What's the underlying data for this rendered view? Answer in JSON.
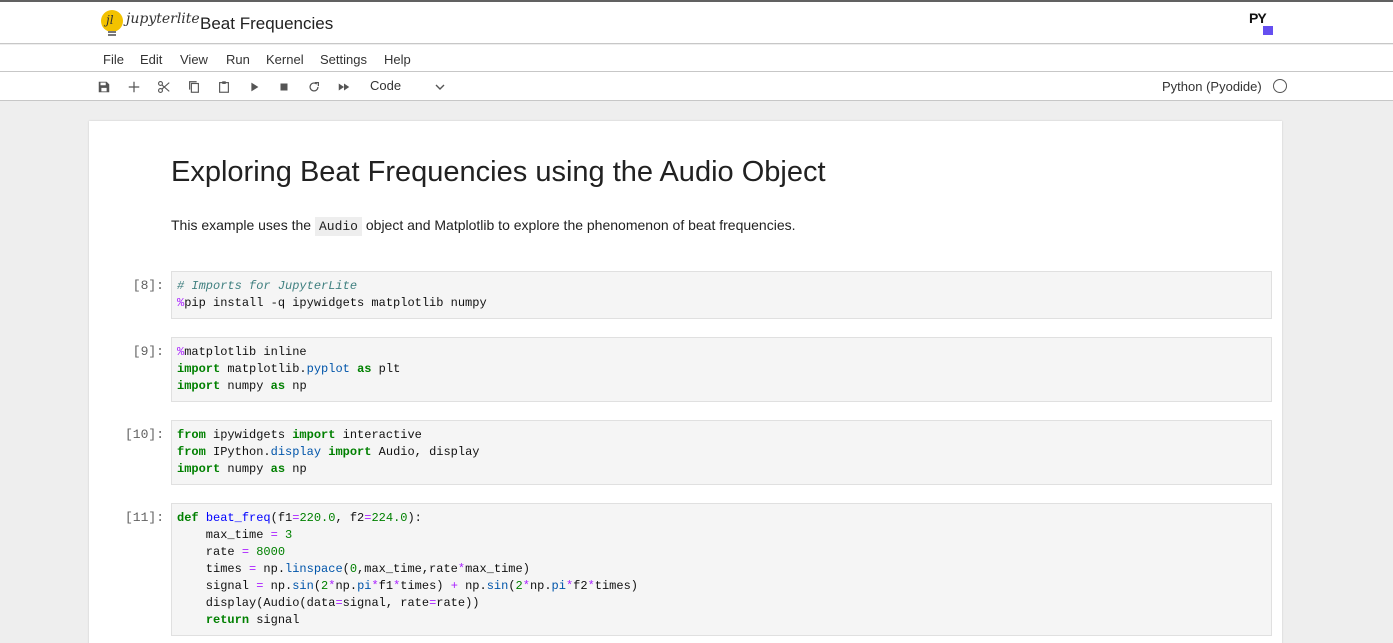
{
  "app": {
    "name": "jupyterlite",
    "document_title": "Beat Frequencies",
    "badge_text": "PY"
  },
  "menu": [
    "File",
    "Edit",
    "View",
    "Run",
    "Kernel",
    "Settings",
    "Help"
  ],
  "toolbar": {
    "buttons": [
      "save-icon",
      "add-icon",
      "cut-icon",
      "copy-icon",
      "paste-icon",
      "run-icon",
      "stop-icon",
      "restart-icon",
      "fast-forward-icon"
    ],
    "cell_type": "Code",
    "kernel_name": "Python (Pyodide)"
  },
  "notebook": {
    "title": "Exploring Beat Frequencies using the Audio Object",
    "intro_before": "This example uses the ",
    "intro_code": "Audio",
    "intro_after": " object and Matplotlib to explore the phenomenon of beat frequencies.",
    "cells": [
      {
        "prompt": "[8]:",
        "lines": [
          [
            {
              "t": "# Imports for JupyterLite",
              "c": "c-com"
            }
          ],
          [
            {
              "t": "%",
              "c": "c-mag"
            },
            {
              "t": "pip install -q ipywidgets matplotlib numpy",
              "c": ""
            }
          ]
        ]
      },
      {
        "prompt": "[9]:",
        "lines": [
          [
            {
              "t": "%",
              "c": "c-mag"
            },
            {
              "t": "matplotlib inline",
              "c": ""
            }
          ],
          [
            {
              "t": "import",
              "c": "c-kw"
            },
            {
              "t": " matplotlib.",
              "c": ""
            },
            {
              "t": "pyplot",
              "c": "c-attr"
            },
            {
              "t": " ",
              "c": ""
            },
            {
              "t": "as",
              "c": "c-kw"
            },
            {
              "t": " plt",
              "c": ""
            }
          ],
          [
            {
              "t": "import",
              "c": "c-kw"
            },
            {
              "t": " numpy ",
              "c": ""
            },
            {
              "t": "as",
              "c": "c-kw"
            },
            {
              "t": " np",
              "c": ""
            }
          ]
        ]
      },
      {
        "prompt": "[10]:",
        "lines": [
          [
            {
              "t": "from",
              "c": "c-kw"
            },
            {
              "t": " ipywidgets ",
              "c": ""
            },
            {
              "t": "import",
              "c": "c-kw"
            },
            {
              "t": " interactive",
              "c": ""
            }
          ],
          [
            {
              "t": "from",
              "c": "c-kw"
            },
            {
              "t": " IPython.",
              "c": ""
            },
            {
              "t": "display",
              "c": "c-attr"
            },
            {
              "t": " ",
              "c": ""
            },
            {
              "t": "import",
              "c": "c-kw"
            },
            {
              "t": " Audio, display",
              "c": ""
            }
          ],
          [
            {
              "t": "import",
              "c": "c-kw"
            },
            {
              "t": " numpy ",
              "c": ""
            },
            {
              "t": "as",
              "c": "c-kw"
            },
            {
              "t": " np",
              "c": ""
            }
          ]
        ]
      },
      {
        "prompt": "[11]:",
        "lines": [
          [
            {
              "t": "def",
              "c": "c-kw"
            },
            {
              "t": " ",
              "c": ""
            },
            {
              "t": "beat_freq",
              "c": "c-def"
            },
            {
              "t": "(f1",
              "c": ""
            },
            {
              "t": "=",
              "c": "c-op"
            },
            {
              "t": "220.0",
              "c": "c-num"
            },
            {
              "t": ", f2",
              "c": ""
            },
            {
              "t": "=",
              "c": "c-op"
            },
            {
              "t": "224.0",
              "c": "c-num"
            },
            {
              "t": "):",
              "c": ""
            }
          ],
          [
            {
              "t": "    max_time ",
              "c": ""
            },
            {
              "t": "=",
              "c": "c-op"
            },
            {
              "t": " ",
              "c": ""
            },
            {
              "t": "3",
              "c": "c-num"
            }
          ],
          [
            {
              "t": "    rate ",
              "c": ""
            },
            {
              "t": "=",
              "c": "c-op"
            },
            {
              "t": " ",
              "c": ""
            },
            {
              "t": "8000",
              "c": "c-num"
            }
          ],
          [
            {
              "t": "    times ",
              "c": ""
            },
            {
              "t": "=",
              "c": "c-op"
            },
            {
              "t": " np.",
              "c": ""
            },
            {
              "t": "linspace",
              "c": "c-attr"
            },
            {
              "t": "(",
              "c": ""
            },
            {
              "t": "0",
              "c": "c-num"
            },
            {
              "t": ",max_time,rate",
              "c": ""
            },
            {
              "t": "*",
              "c": "c-op"
            },
            {
              "t": "max_time)",
              "c": ""
            }
          ],
          [
            {
              "t": "    signal ",
              "c": ""
            },
            {
              "t": "=",
              "c": "c-op"
            },
            {
              "t": " np.",
              "c": ""
            },
            {
              "t": "sin",
              "c": "c-attr"
            },
            {
              "t": "(",
              "c": ""
            },
            {
              "t": "2",
              "c": "c-num"
            },
            {
              "t": "*",
              "c": "c-op"
            },
            {
              "t": "np.",
              "c": ""
            },
            {
              "t": "pi",
              "c": "c-attr"
            },
            {
              "t": "*",
              "c": "c-op"
            },
            {
              "t": "f1",
              "c": ""
            },
            {
              "t": "*",
              "c": "c-op"
            },
            {
              "t": "times) ",
              "c": ""
            },
            {
              "t": "+",
              "c": "c-op"
            },
            {
              "t": " np.",
              "c": ""
            },
            {
              "t": "sin",
              "c": "c-attr"
            },
            {
              "t": "(",
              "c": ""
            },
            {
              "t": "2",
              "c": "c-num"
            },
            {
              "t": "*",
              "c": "c-op"
            },
            {
              "t": "np.",
              "c": ""
            },
            {
              "t": "pi",
              "c": "c-attr"
            },
            {
              "t": "*",
              "c": "c-op"
            },
            {
              "t": "f2",
              "c": ""
            },
            {
              "t": "*",
              "c": "c-op"
            },
            {
              "t": "times)",
              "c": ""
            }
          ],
          [
            {
              "t": "    display(Audio(data",
              "c": ""
            },
            {
              "t": "=",
              "c": "c-op"
            },
            {
              "t": "signal, rate",
              "c": ""
            },
            {
              "t": "=",
              "c": "c-op"
            },
            {
              "t": "rate))",
              "c": ""
            }
          ],
          [
            {
              "t": "    ",
              "c": ""
            },
            {
              "t": "return",
              "c": "c-kw"
            },
            {
              "t": " signal",
              "c": ""
            }
          ]
        ]
      }
    ]
  }
}
